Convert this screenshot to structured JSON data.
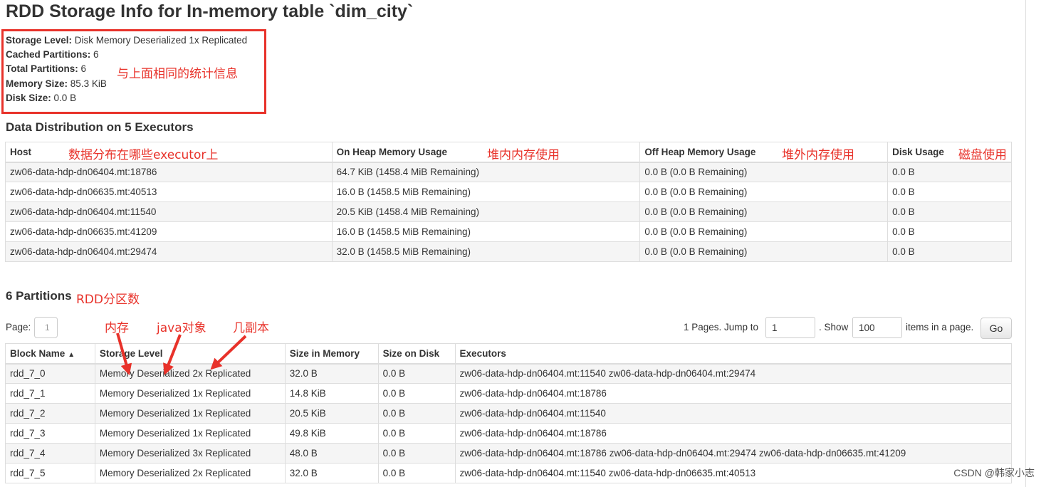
{
  "page": {
    "title": "RDD Storage Info for In-memory table `dim_city`"
  },
  "summary": [
    {
      "label": "Storage Level:",
      "value": "Disk Memory Deserialized 1x Replicated"
    },
    {
      "label": "Cached Partitions:",
      "value": "6"
    },
    {
      "label": "Total Partitions:",
      "value": "6"
    },
    {
      "label": "Memory Size:",
      "value": "85.3 KiB"
    },
    {
      "label": "Disk Size:",
      "value": "0.0 B"
    }
  ],
  "annotations": {
    "summary_note": "与上面相同的统计信息",
    "host_note": "数据分布在哪些executor上",
    "on_heap_note": "堆内内存使用",
    "off_heap_note": "堆外内存使用",
    "disk_note": "磁盘使用",
    "partitions_note": "RDD分区数",
    "memory_note": "内存",
    "java_note": "java对象",
    "replica_note": "几副本",
    "color": "#e8322a"
  },
  "distribution": {
    "title": "Data Distribution on 5 Executors",
    "columns": [
      "Host",
      "On Heap Memory Usage",
      "Off Heap Memory Usage",
      "Disk Usage"
    ],
    "rows": [
      [
        "zw06-data-hdp-dn06404.mt:18786",
        "64.7 KiB (1458.4 MiB Remaining)",
        "0.0 B (0.0 B Remaining)",
        "0.0 B"
      ],
      [
        "zw06-data-hdp-dn06635.mt:40513",
        "16.0 B (1458.5 MiB Remaining)",
        "0.0 B (0.0 B Remaining)",
        "0.0 B"
      ],
      [
        "zw06-data-hdp-dn06404.mt:11540",
        "20.5 KiB (1458.4 MiB Remaining)",
        "0.0 B (0.0 B Remaining)",
        "0.0 B"
      ],
      [
        "zw06-data-hdp-dn06635.mt:41209",
        "16.0 B (1458.5 MiB Remaining)",
        "0.0 B (0.0 B Remaining)",
        "0.0 B"
      ],
      [
        "zw06-data-hdp-dn06404.mt:29474",
        "32.0 B (1458.5 MiB Remaining)",
        "0.0 B (0.0 B Remaining)",
        "0.0 B"
      ]
    ]
  },
  "partitions": {
    "title": "6 Partitions",
    "page_label": "Page:",
    "page_value": "1",
    "pages_text": "1 Pages. Jump to",
    "jump_value": "1",
    "show_text": ". Show",
    "show_value": "100",
    "items_text": "items in a page.",
    "go_label": "Go",
    "sort_indicator": "▲",
    "columns": [
      "Block Name",
      "Storage Level",
      "Size in Memory",
      "Size on Disk",
      "Executors"
    ],
    "rows": [
      [
        "rdd_7_0",
        "Memory Deserialized 2x Replicated",
        "32.0 B",
        "0.0 B",
        "zw06-data-hdp-dn06404.mt:11540 zw06-data-hdp-dn06404.mt:29474"
      ],
      [
        "rdd_7_1",
        "Memory Deserialized 1x Replicated",
        "14.8 KiB",
        "0.0 B",
        "zw06-data-hdp-dn06404.mt:18786"
      ],
      [
        "rdd_7_2",
        "Memory Deserialized 1x Replicated",
        "20.5 KiB",
        "0.0 B",
        "zw06-data-hdp-dn06404.mt:11540"
      ],
      [
        "rdd_7_3",
        "Memory Deserialized 1x Replicated",
        "49.8 KiB",
        "0.0 B",
        "zw06-data-hdp-dn06404.mt:18786"
      ],
      [
        "rdd_7_4",
        "Memory Deserialized 3x Replicated",
        "48.0 B",
        "0.0 B",
        "zw06-data-hdp-dn06404.mt:18786 zw06-data-hdp-dn06404.mt:29474 zw06-data-hdp-dn06635.mt:41209"
      ],
      [
        "rdd_7_5",
        "Memory Deserialized 2x Replicated",
        "32.0 B",
        "0.0 B",
        "zw06-data-hdp-dn06404.mt:11540 zw06-data-hdp-dn06635.mt:40513"
      ]
    ]
  },
  "watermark": "CSDN @韩家小志"
}
